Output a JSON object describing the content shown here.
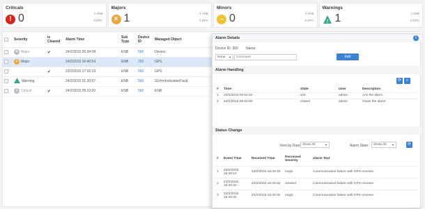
{
  "summary": [
    {
      "title": "Criticals",
      "count": "0",
      "enb": "0 eNB",
      "epc": "0 EPC",
      "color": "#d9261c",
      "icon": "exclamation-icon"
    },
    {
      "title": "Majors",
      "count": "1",
      "enb": "1 eNB",
      "epc": "0 EPC",
      "color": "#f0a43a",
      "icon": "x-icon"
    },
    {
      "title": "Minors",
      "count": "0",
      "enb": "0 eNB",
      "epc": "0 EPC",
      "color": "#f2c231",
      "icon": "minus-icon"
    },
    {
      "title": "Warnings",
      "count": "1",
      "enb": "1 eNB",
      "epc": "0 EPC",
      "color": "#3aa68c",
      "icon": "triangle-icon"
    }
  ],
  "table": {
    "headers": [
      "Severity",
      "Is Cleared",
      "Alarm Time",
      "Sub Type",
      "Device ID",
      "Managed Object"
    ],
    "rows": [
      {
        "severity": "Major",
        "cleared": "✔",
        "time": "24/2/2015 00:34:08",
        "subtype": "ENB",
        "device": "560",
        "object": "Device"
      },
      {
        "severity": "Major",
        "cleared": "",
        "time": "24/2/2015 16:40:54",
        "subtype": "ENB",
        "device": "350",
        "object": "GPS"
      },
      {
        "severity": "",
        "cleared": "✔",
        "time": "23/2/2015 17:02:19",
        "subtype": "ENB",
        "device": "560",
        "object": "GPS"
      },
      {
        "severity": "Warning",
        "cleared": "",
        "time": "24/2/2015 01:20:07",
        "subtype": "ENB",
        "device": "560",
        "object": "S1#rmIndicationFault"
      },
      {
        "severity": "Critical",
        "cleared": "✔",
        "time": "24/2/2015 08:23:20",
        "subtype": "ENB",
        "device": "560",
        "object": "ENB"
      }
    ]
  },
  "panel": {
    "title": "Alarm Details",
    "device_label": "Device ID: 350",
    "name_label": "Name:",
    "select_value": "None",
    "comment_placeholder": "Comment",
    "add_label": "Add",
    "handling_title": "Alarm Handling",
    "handling_headers": [
      "#",
      "Time",
      "State",
      "User",
      "Description"
    ],
    "handling_rows": [
      {
        "n": "1",
        "time": "24/2/2015 09:52:44",
        "state": "ack",
        "user": "admin",
        "desc": "Ack the alarm"
      },
      {
        "n": "2",
        "time": "24/2/2015 09:52:50",
        "state": "closed",
        "user": "admin",
        "desc": "Close the alarm"
      }
    ],
    "status_title": "Status Change",
    "view_by_dates_label": "View by Dates:",
    "view_by_dates_value": "Show All",
    "alarm_state_label": "Alarm State:",
    "alarm_state_value": "Show All",
    "status_headers": [
      "#",
      "Event Time",
      "Received Time",
      "Perceived Severity",
      "Alarm Text"
    ],
    "status_rows": [
      {
        "n": "1",
        "event": "23/2/2015 16:40:10",
        "received": "23/2/2015 16:40:10",
        "sev": "major",
        "text": "Communication failure with GPS receiver"
      },
      {
        "n": "2",
        "event": "23/2/2015 16:40:32",
        "received": "23/2/2015 16:40:32",
        "sev": "cleared",
        "text": "Communication failure with GPS receiver"
      },
      {
        "n": "3",
        "event": "23/2/2015 16:40:34",
        "received": "23/2/2015 16:40:34",
        "sev": "major",
        "text": "Communication failure with GPS receiver"
      }
    ]
  }
}
